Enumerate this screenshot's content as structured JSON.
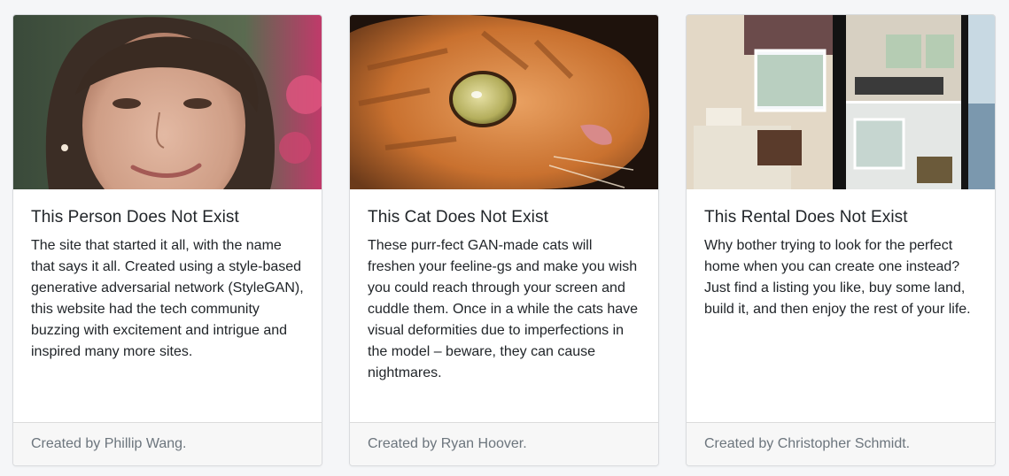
{
  "cards": [
    {
      "title": "This Person Does Not Exist",
      "text": "The site that started it all, with the name that says it all. Created using a style-based generative adversarial network (StyleGAN), this website had the tech community buzzing with excitement and intrigue and inspired many more sites.",
      "footer": "Created by Phillip Wang.",
      "image": "generated-person-photo"
    },
    {
      "title": "This Cat Does Not Exist",
      "text": "These purr-fect GAN-made cats will freshen your feeline-gs and make you wish you could reach through your screen and cuddle them. Once in a while the cats have visual deformities due to imperfections in the model – beware, they can cause nightmares.",
      "footer": "Created by Ryan Hoover.",
      "image": "generated-cat-photo"
    },
    {
      "title": "This Rental Does Not Exist",
      "text": "Why bother trying to look for the perfect home when you can create one instead? Just find a listing you like, buy some land, build it, and then enjoy the rest of your life.",
      "footer": "Created by Christopher Schmidt.",
      "image": "generated-rental-photos"
    }
  ]
}
